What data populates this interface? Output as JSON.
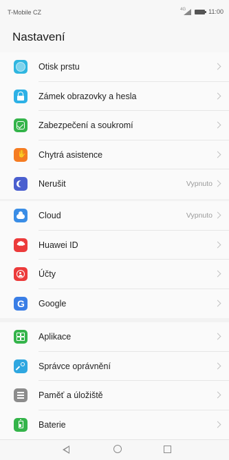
{
  "status_bar": {
    "carrier": "T-Mobile CZ",
    "time": "11:00",
    "signal_icon": "signal-4g-icon",
    "battery_icon": "battery-icon"
  },
  "header": {
    "title": "Nastavení"
  },
  "groups": [
    {
      "items": [
        {
          "label": "Otisk prstu",
          "icon": "fingerprint-icon",
          "color": "#2fb6e0",
          "value": ""
        },
        {
          "label": "Zámek obrazovky a hesla",
          "icon": "lock-icon",
          "color": "#2db1e6",
          "value": ""
        },
        {
          "label": "Zabezpečení a soukromí",
          "icon": "shield-check-icon",
          "color": "#34b44a",
          "value": ""
        },
        {
          "label": "Chytrá asistence",
          "icon": "hand-icon",
          "color": "#f57c22",
          "value": ""
        },
        {
          "label": "Nerušit",
          "icon": "moon-icon",
          "color": "#4a5fcf",
          "value": "Vypnuto"
        }
      ]
    },
    {
      "items": [
        {
          "label": "Cloud",
          "icon": "cloud-icon",
          "color": "#3a8de6",
          "value": "Vypnuto"
        },
        {
          "label": "Huawei ID",
          "icon": "huawei-logo-icon",
          "color": "#ec3b3b",
          "value": ""
        },
        {
          "label": "Účty",
          "icon": "account-icon",
          "color": "#ec3b3b",
          "value": ""
        },
        {
          "label": "Google",
          "icon": "google-icon",
          "color": "#3a7ee6",
          "value": ""
        }
      ]
    },
    {
      "items": [
        {
          "label": "Aplikace",
          "icon": "apps-grid-icon",
          "color": "#34b44a",
          "value": ""
        },
        {
          "label": "Správce oprávnění",
          "icon": "key-icon",
          "color": "#2fa7e0",
          "value": ""
        },
        {
          "label": "Paměť a úložiště",
          "icon": "storage-icon",
          "color": "#8c8c8c",
          "value": ""
        },
        {
          "label": "Baterie",
          "icon": "battery-settings-icon",
          "color": "#34b44a",
          "value": ""
        }
      ]
    }
  ],
  "nav_bar": {
    "back_icon": "back-triangle-icon",
    "home_icon": "home-circle-icon",
    "recent_icon": "recent-square-icon"
  }
}
